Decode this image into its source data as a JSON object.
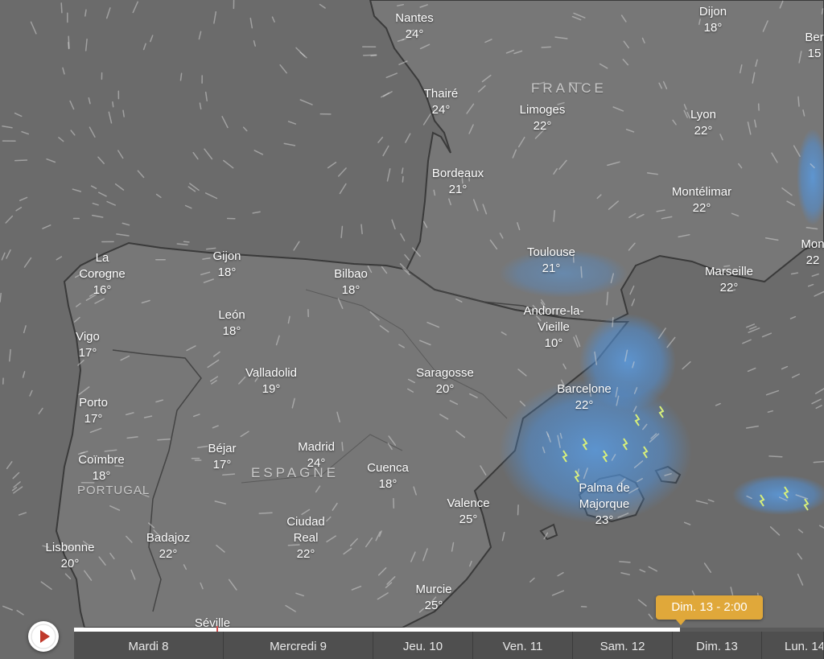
{
  "map": {
    "colors": {
      "sea": "#6b6b6b",
      "land": "#777777",
      "coast": "#3a3a3a",
      "rain": "#4f8fd6",
      "lightning": "#d8f07a"
    },
    "countries": [
      {
        "id": "france",
        "label": "FRANCE"
      },
      {
        "id": "espagne",
        "label": "ESPAGNE"
      },
      {
        "id": "portugal",
        "label": "PORTUGAL"
      }
    ],
    "cities": [
      {
        "id": "nantes",
        "name": "Nantes",
        "temp": "24°"
      },
      {
        "id": "dijon",
        "name": "Dijon",
        "temp": "18°"
      },
      {
        "id": "bern",
        "name": "Ber",
        "temp": "15"
      },
      {
        "id": "thaire",
        "name": "Thairé",
        "temp": "24°"
      },
      {
        "id": "limoges",
        "name": "Limoges",
        "temp": "22°"
      },
      {
        "id": "lyon",
        "name": "Lyon",
        "temp": "22°"
      },
      {
        "id": "bordeaux",
        "name": "Bordeaux",
        "temp": "21°"
      },
      {
        "id": "montelimar",
        "name": "Montélimar",
        "temp": "22°"
      },
      {
        "id": "monaco",
        "name": "Mon",
        "temp": "22"
      },
      {
        "id": "toulouse",
        "name": "Toulouse",
        "temp": "21°"
      },
      {
        "id": "marseille",
        "name": "Marseille",
        "temp": "22°"
      },
      {
        "id": "la-corogne",
        "name": "La\nCorogne",
        "temp": "16°"
      },
      {
        "id": "gijon",
        "name": "Gijon",
        "temp": "18°"
      },
      {
        "id": "bilbao",
        "name": "Bilbao",
        "temp": "18°"
      },
      {
        "id": "andorre",
        "name": "Andorre-la-\nVieille",
        "temp": "10°"
      },
      {
        "id": "vigo",
        "name": "Vigo",
        "temp": "17°"
      },
      {
        "id": "leon",
        "name": "León",
        "temp": "18°"
      },
      {
        "id": "valladolid",
        "name": "Valladolid",
        "temp": "19°"
      },
      {
        "id": "saragosse",
        "name": "Saragosse",
        "temp": "20°"
      },
      {
        "id": "barcelone",
        "name": "Barcelone",
        "temp": "22°"
      },
      {
        "id": "porto",
        "name": "Porto",
        "temp": "17°"
      },
      {
        "id": "bejar",
        "name": "Béjar",
        "temp": "17°"
      },
      {
        "id": "madrid",
        "name": "Madrid",
        "temp": "24°"
      },
      {
        "id": "coimbre",
        "name": "Coïmbre",
        "temp": "18°"
      },
      {
        "id": "cuenca",
        "name": "Cuenca",
        "temp": "18°"
      },
      {
        "id": "palma",
        "name": "Palma de\nMajorque",
        "temp": "23°"
      },
      {
        "id": "valence",
        "name": "Valence",
        "temp": "25°"
      },
      {
        "id": "ciudad-real",
        "name": "Ciudad\nReal",
        "temp": "22°"
      },
      {
        "id": "badajoz",
        "name": "Badajoz",
        "temp": "22°"
      },
      {
        "id": "lisbonne",
        "name": "Lisbonne",
        "temp": "20°"
      },
      {
        "id": "murcie",
        "name": "Murcie",
        "temp": "25°"
      },
      {
        "id": "seville",
        "name": "Séville",
        "temp": ""
      }
    ]
  },
  "timeline": {
    "tooltip": "Dim. 13 - 2:00",
    "progress": 0.808,
    "days": [
      "Mardi 8",
      "Mercredi 9",
      "Jeu. 10",
      "Ven. 11",
      "Sam. 12",
      "Dim. 13",
      "Lun. 14"
    ],
    "colors": {
      "bar": "#4f4f4f",
      "tooltip": "#e0a83a",
      "play": "#c0392b"
    }
  }
}
